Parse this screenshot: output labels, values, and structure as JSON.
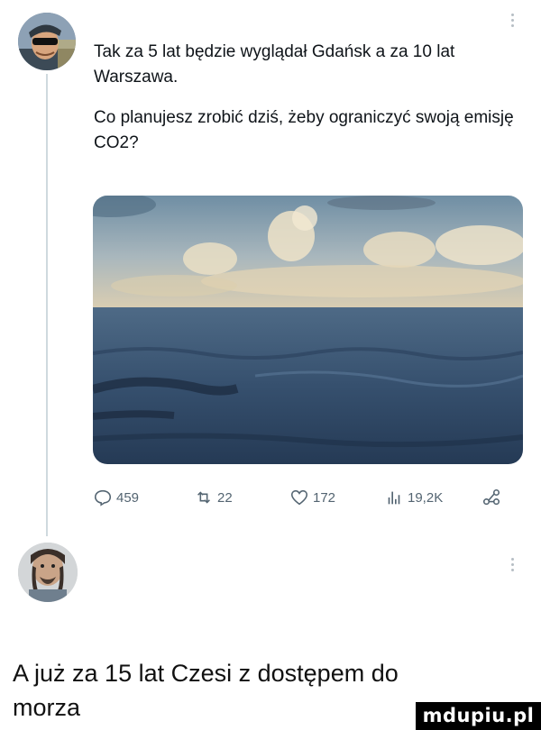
{
  "tweet": {
    "paragraph_1": "Tak za 5 lat będzie wyglądał Gdańsk a za 10 lat Warszawa.",
    "paragraph_2": "Co planujesz zrobić dziś, żeby ograniczyć swoją emisję CO2?",
    "image_description_icon": "sea-horizon-photo",
    "actions": {
      "replies": "459",
      "retweets": "22",
      "likes": "172",
      "views": "19,2K"
    }
  },
  "reply": {
    "avatar_icon": "user-avatar"
  },
  "caption": "A już za 15 lat Czesi z dostępem do morza",
  "watermark": "mdupiu.pl",
  "colors": {
    "text": "#0f1419",
    "muted": "#536471",
    "thread_line": "#cfd9de"
  }
}
